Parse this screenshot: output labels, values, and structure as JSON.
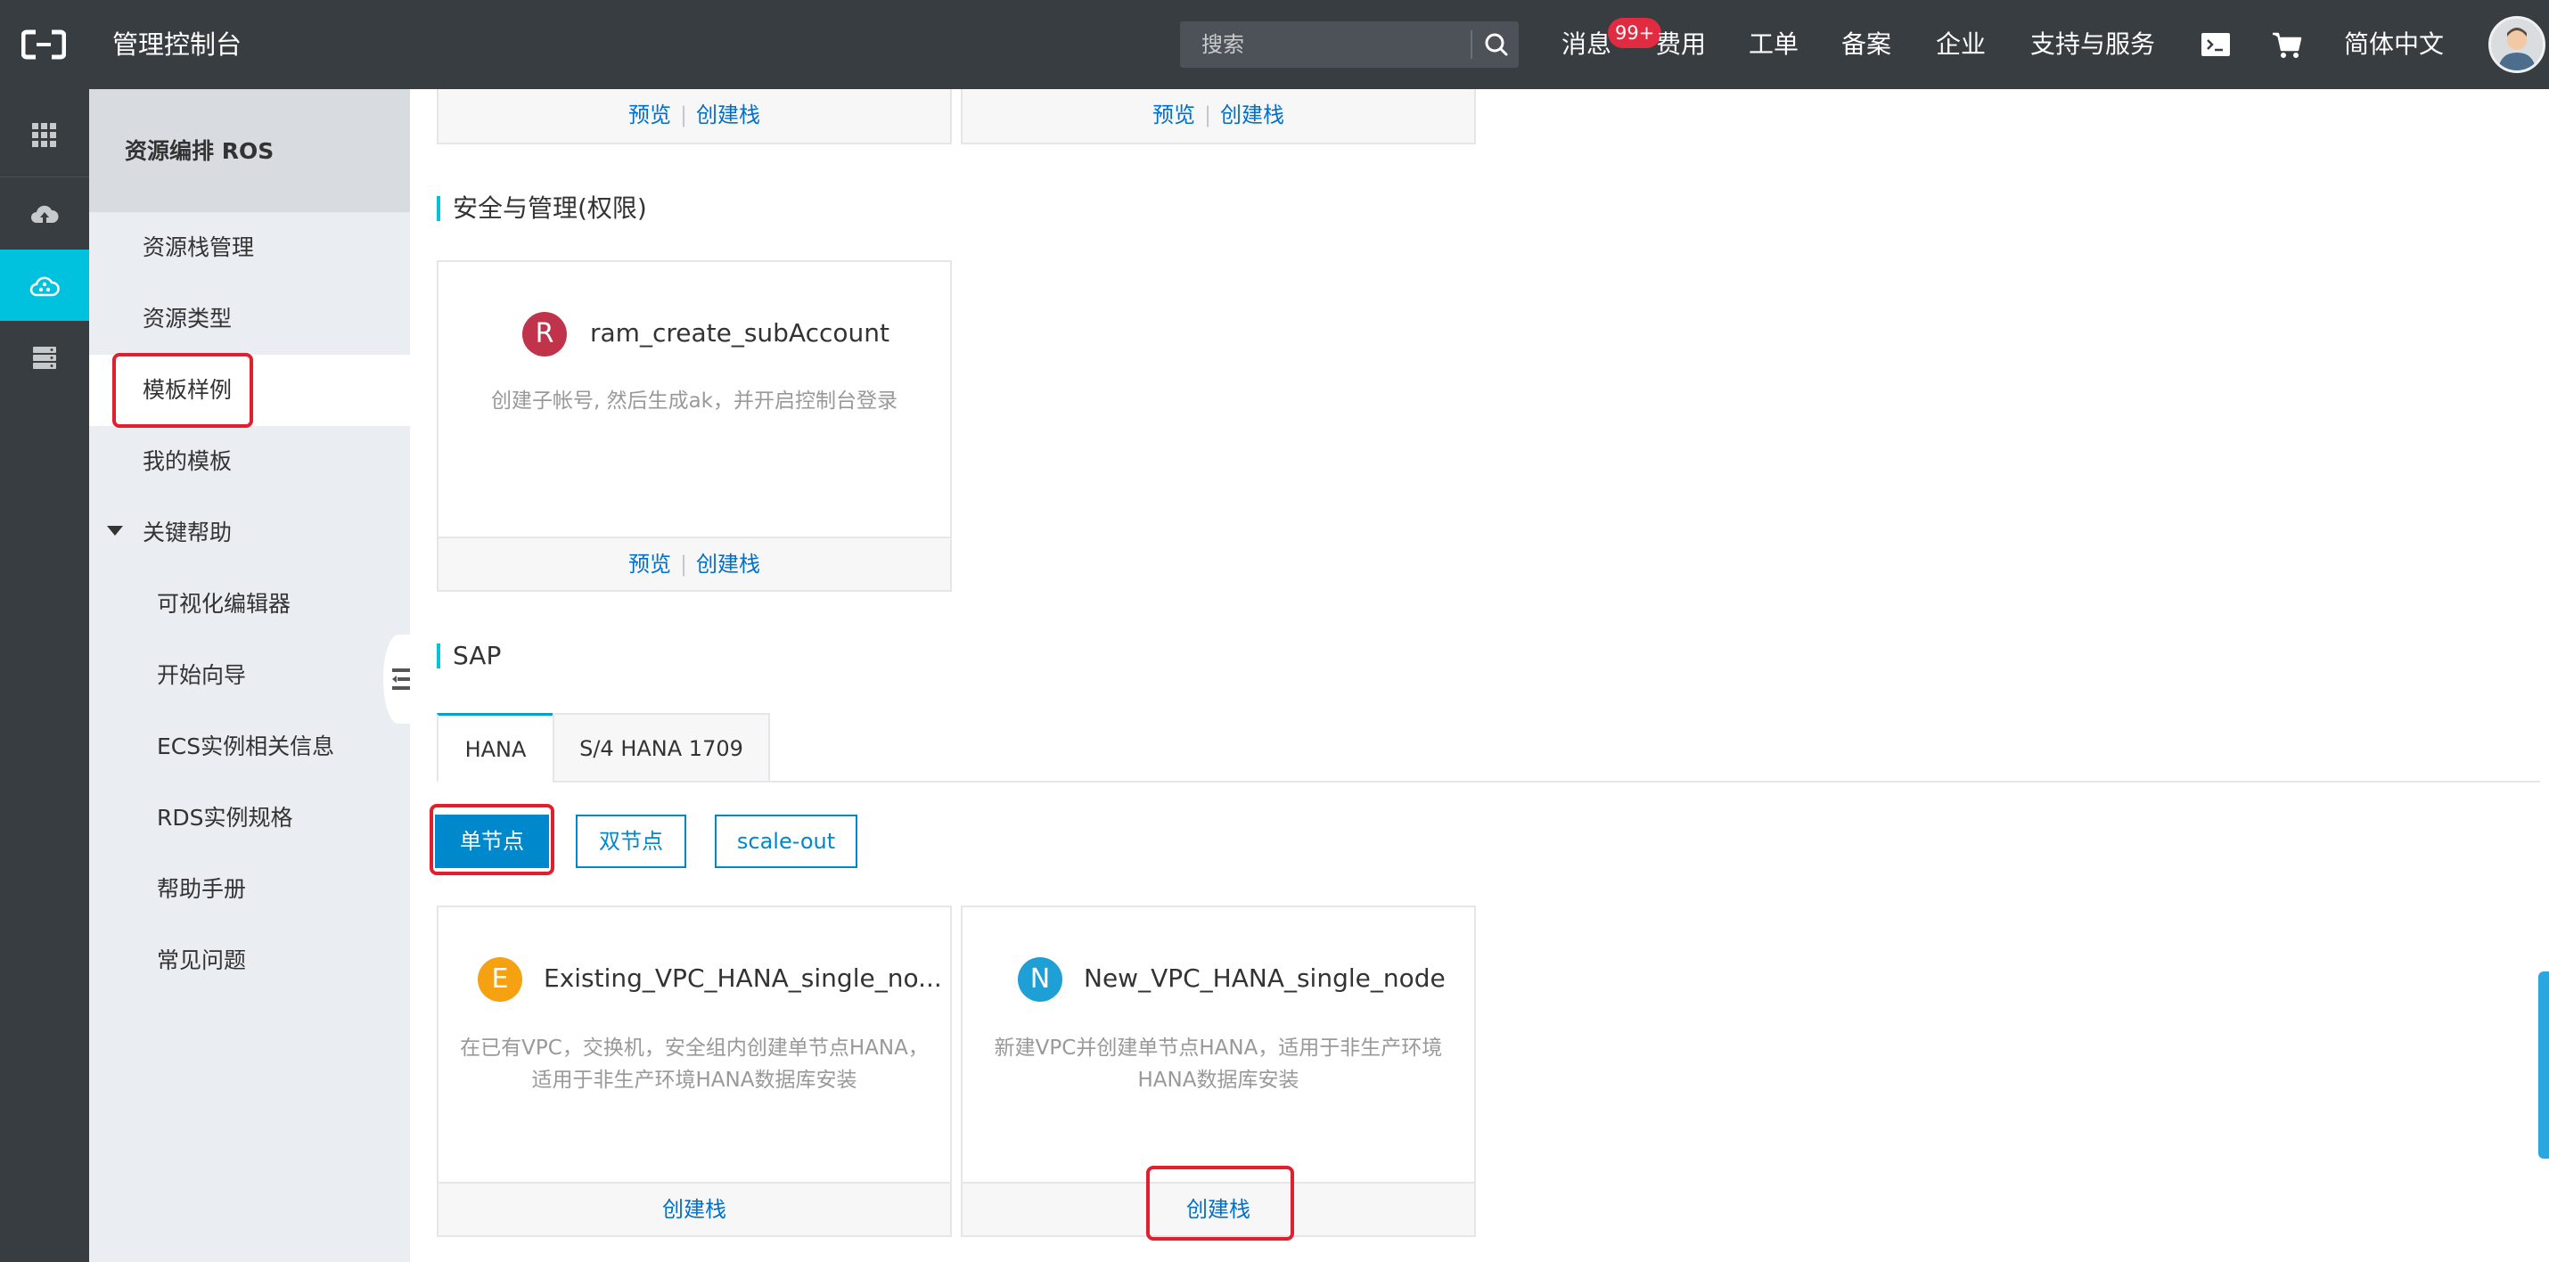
{
  "header": {
    "title": "管理控制台",
    "search_placeholder": "搜索",
    "nav": {
      "messages": "消息",
      "messages_badge": "99+",
      "billing": "费用",
      "tickets": "工单",
      "filing": "备案",
      "enterprise": "企业",
      "support": "支持与服务",
      "language": "简体中文"
    }
  },
  "sidebar": {
    "title": "资源编排 ROS",
    "items": [
      {
        "label": "资源栈管理"
      },
      {
        "label": "资源类型"
      },
      {
        "label": "模板样例"
      },
      {
        "label": "我的模板"
      },
      {
        "label": "关键帮助"
      },
      {
        "label": "可视化编辑器"
      },
      {
        "label": "开始向导"
      },
      {
        "label": "ECS实例相关信息"
      },
      {
        "label": "RDS实例规格"
      },
      {
        "label": "帮助手册"
      },
      {
        "label": "常见问题"
      }
    ]
  },
  "actions": {
    "preview": "预览",
    "create_stack": "创建栈"
  },
  "sections": {
    "security": {
      "title": "安全与管理(权限)",
      "cards": [
        {
          "letter": "R",
          "color": "#c0334a",
          "title": "ram_create_subAccount",
          "desc": "创建子帐号, 然后生成ak，并开启控制台登录"
        }
      ]
    },
    "sap": {
      "title": "SAP",
      "tabs": [
        {
          "label": "HANA"
        },
        {
          "label": "S/4 HANA 1709"
        }
      ],
      "filters": [
        {
          "label": "单节点"
        },
        {
          "label": "双节点"
        },
        {
          "label": "scale-out"
        }
      ],
      "cards": [
        {
          "letter": "E",
          "color": "#f6a112",
          "title": "Existing_VPC_HANA_single_no...",
          "desc_lines": [
            "在已有VPC，交换机，安全组内创建单节点HANA，",
            "适用于非生产环境HANA数据库安装"
          ]
        },
        {
          "letter": "N",
          "color": "#1e9fd6",
          "title": "New_VPC_HANA_single_node",
          "desc_lines": [
            "新建VPC并创建单节点HANA，适用于非生产环境",
            "HANA数据库安装"
          ]
        }
      ]
    }
  },
  "colors": {
    "topbar": "#373d41",
    "accent": "#00c1de",
    "link": "#0070cc",
    "highlight": "#e0202e"
  }
}
